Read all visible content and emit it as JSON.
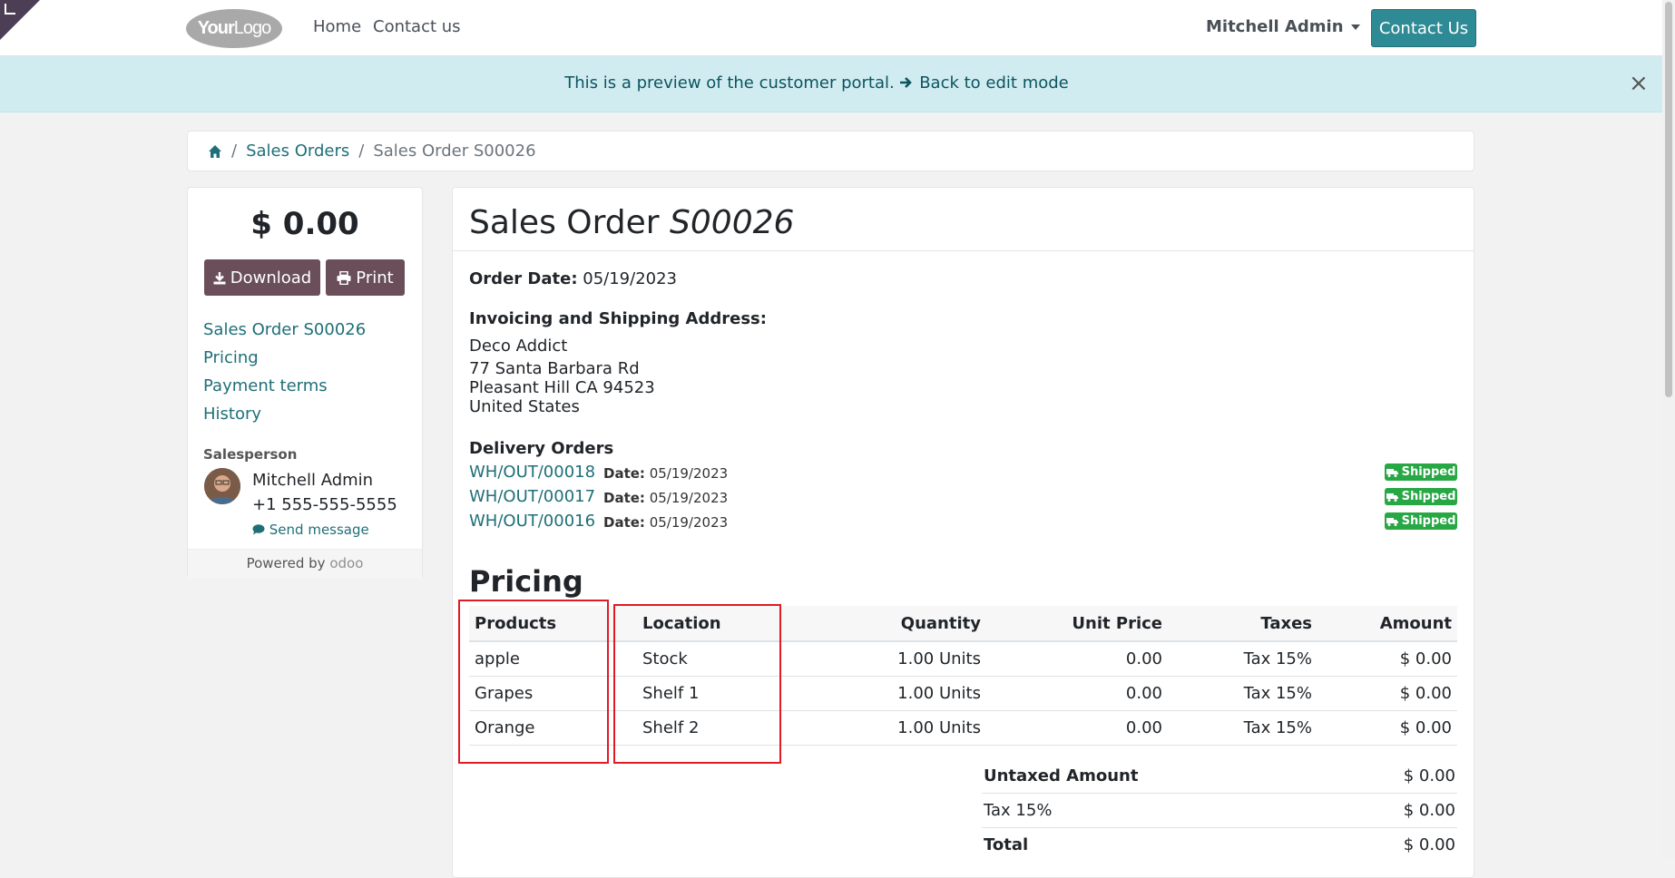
{
  "navbar": {
    "logo_a": "Your",
    "logo_b": "Logo",
    "links": [
      "Home",
      "Contact us"
    ],
    "user": "Mitchell Admin",
    "contact_button": "Contact Us"
  },
  "preview": {
    "text": "This is a preview of the customer portal.",
    "back_link": "Back to edit mode",
    "close": "×"
  },
  "breadcrumb": {
    "sales_orders": "Sales Orders",
    "current": "Sales Order S00026"
  },
  "sidebar": {
    "total": "$ 0.00",
    "download": "Download",
    "print": "Print",
    "links": [
      "Sales Order S00026",
      "Pricing",
      "Payment terms",
      "History"
    ],
    "salesperson_label": "Salesperson",
    "salesperson_name": "Mitchell Admin",
    "salesperson_phone": "+1 555-555-5555",
    "send_message": "Send message",
    "powered_by": "Powered by",
    "odoo": "odoo"
  },
  "order": {
    "title": "Sales Order",
    "number": "S00026",
    "order_date_label": "Order Date:",
    "order_date": "05/19/2023",
    "address_label": "Invoicing and Shipping Address:",
    "address_name": "Deco Addict",
    "address_lines": [
      "77 Santa Barbara Rd",
      "Pleasant Hill CA 94523",
      "United States"
    ],
    "delivery_label": "Delivery Orders",
    "date_label": "Date:",
    "deliveries": [
      {
        "ref": "WH/OUT/00018",
        "date": "05/19/2023",
        "status": "Shipped"
      },
      {
        "ref": "WH/OUT/00017",
        "date": "05/19/2023",
        "status": "Shipped"
      },
      {
        "ref": "WH/OUT/00016",
        "date": "05/19/2023",
        "status": "Shipped"
      }
    ]
  },
  "pricing": {
    "heading": "Pricing",
    "columns": [
      "Products",
      "Location",
      "Quantity",
      "Unit Price",
      "Taxes",
      "Amount"
    ],
    "rows": [
      [
        "apple",
        "Stock",
        "1.00 Units",
        "0.00",
        "Tax 15%",
        "$ 0.00"
      ],
      [
        "Grapes",
        "Shelf 1",
        "1.00 Units",
        "0.00",
        "Tax 15%",
        "$ 0.00"
      ],
      [
        "Orange",
        "Shelf 2",
        "1.00 Units",
        "0.00",
        "Tax 15%",
        "$ 0.00"
      ]
    ],
    "totals": [
      {
        "label": "Untaxed Amount",
        "value": "$ 0.00"
      },
      {
        "label": "Tax 15%",
        "value": "$ 0.00"
      },
      {
        "label": "Total",
        "value": "$ 0.00"
      }
    ]
  },
  "colors": {
    "primary": "#2e8a94",
    "link": "#1f6f78",
    "secondary_button": "#6a4e5a",
    "preview_bg": "#d1ecf1",
    "badge_success": "#28a745",
    "highlight_box": "#e01b24"
  }
}
